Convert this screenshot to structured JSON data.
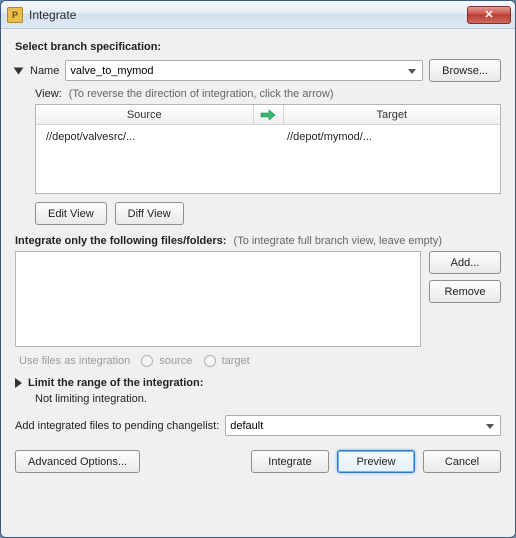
{
  "window": {
    "title": "Integrate",
    "close": "✕"
  },
  "branch": {
    "heading": "Select branch specification:",
    "name_label": "Name",
    "name_value": "valve_to_mymod",
    "browse": "Browse...",
    "view_label": "View:",
    "view_hint": "(To reverse the direction of integration, click the arrow)",
    "columns": {
      "source": "Source",
      "target": "Target"
    },
    "rows": [
      {
        "source": "//depot/valvesrc/...",
        "target": "//depot/mymod/..."
      }
    ],
    "edit_view": "Edit View",
    "diff_view": "Diff View"
  },
  "files": {
    "heading": "Integrate only the following files/folders:",
    "hint": "(To integrate full branch view, leave empty)",
    "add": "Add...",
    "remove": "Remove",
    "use_as_label": "Use files as integration",
    "opt_source": "source",
    "opt_target": "target"
  },
  "limit": {
    "heading": "Limit the range of the integration:",
    "status": "Not limiting integration."
  },
  "changelist": {
    "label": "Add integrated files to pending changelist:",
    "value": "default"
  },
  "buttons": {
    "advanced": "Advanced Options...",
    "integrate": "Integrate",
    "preview": "Preview",
    "cancel": "Cancel"
  }
}
